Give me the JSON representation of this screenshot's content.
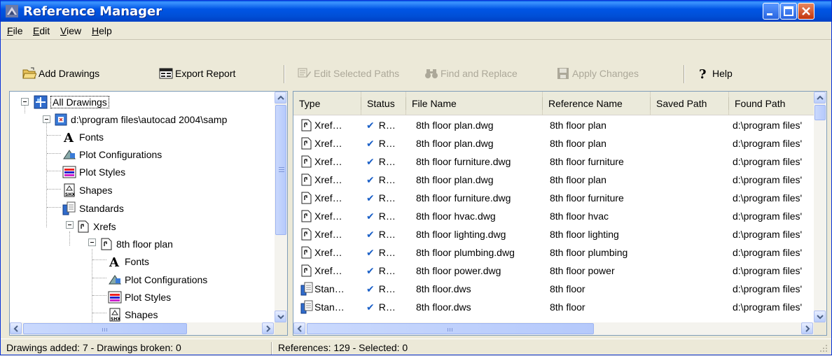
{
  "window": {
    "title": "Reference Manager"
  },
  "menu": [
    {
      "accel": "F",
      "rest": "ile"
    },
    {
      "accel": "E",
      "rest": "dit"
    },
    {
      "accel": "V",
      "rest": "iew"
    },
    {
      "accel": "H",
      "rest": "elp"
    }
  ],
  "toolbar": {
    "add_drawings": "Add Drawings",
    "export_report": "Export Report",
    "edit_paths": "Edit Selected Paths",
    "find_replace": "Find and Replace",
    "apply_changes": "Apply Changes",
    "help": "Help"
  },
  "tree": {
    "root": "All Drawings",
    "drawing": "d:\\program files\\autocad 2004\\samp",
    "children": [
      "Fonts",
      "Plot Configurations",
      "Plot Styles",
      "Shapes",
      "Standards",
      "Xrefs"
    ],
    "xref": "8th floor plan",
    "xref_children": [
      "Fonts",
      "Plot Configurations",
      "Plot Styles",
      "Shapes"
    ]
  },
  "list": {
    "columns": [
      "Type",
      "Status",
      "File Name",
      "Reference Name",
      "Saved Path",
      "Found Path"
    ],
    "rows": [
      {
        "type": "Xref…",
        "status": "R…",
        "file": "8th floor plan.dwg",
        "ref": "8th floor plan",
        "saved": "",
        "found": "d:\\program files'"
      },
      {
        "type": "Xref…",
        "status": "R…",
        "file": "8th floor plan.dwg",
        "ref": "8th floor plan",
        "saved": "",
        "found": "d:\\program files'"
      },
      {
        "type": "Xref…",
        "status": "R…",
        "file": "8th floor furniture.dwg",
        "ref": "8th floor furniture",
        "saved": "",
        "found": "d:\\program files'"
      },
      {
        "type": "Xref…",
        "status": "R…",
        "file": "8th floor plan.dwg",
        "ref": "8th floor plan",
        "saved": "",
        "found": "d:\\program files'"
      },
      {
        "type": "Xref…",
        "status": "R…",
        "file": "8th floor furniture.dwg",
        "ref": "8th floor furniture",
        "saved": "",
        "found": "d:\\program files'"
      },
      {
        "type": "Xref…",
        "status": "R…",
        "file": "8th floor hvac.dwg",
        "ref": "8th floor hvac",
        "saved": "",
        "found": "d:\\program files'"
      },
      {
        "type": "Xref…",
        "status": "R…",
        "file": "8th floor lighting.dwg",
        "ref": "8th floor lighting",
        "saved": "",
        "found": "d:\\program files'"
      },
      {
        "type": "Xref…",
        "status": "R…",
        "file": "8th floor plumbing.dwg",
        "ref": "8th floor plumbing",
        "saved": "",
        "found": "d:\\program files'"
      },
      {
        "type": "Xref…",
        "status": "R…",
        "file": "8th floor power.dwg",
        "ref": "8th floor power",
        "saved": "",
        "found": "d:\\program files'"
      },
      {
        "type": "Stan…",
        "status": "R…",
        "file": "8th floor.dws",
        "ref": "8th floor",
        "saved": "",
        "found": "d:\\program files'"
      },
      {
        "type": "Stan…",
        "status": "R…",
        "file": "8th floor.dws",
        "ref": "8th floor",
        "saved": "",
        "found": "d:\\program files'"
      }
    ]
  },
  "status": {
    "left": "Drawings added: 7  -  Drawings broken: 0",
    "right": "References: 129  -  Selected: 0"
  },
  "colors": {
    "titlebar": "#0055e5",
    "check": "#1a5fc7"
  },
  "icons": {
    "xref": "xref-icon",
    "standards": "standards-icon",
    "check": "checkmark-icon"
  }
}
